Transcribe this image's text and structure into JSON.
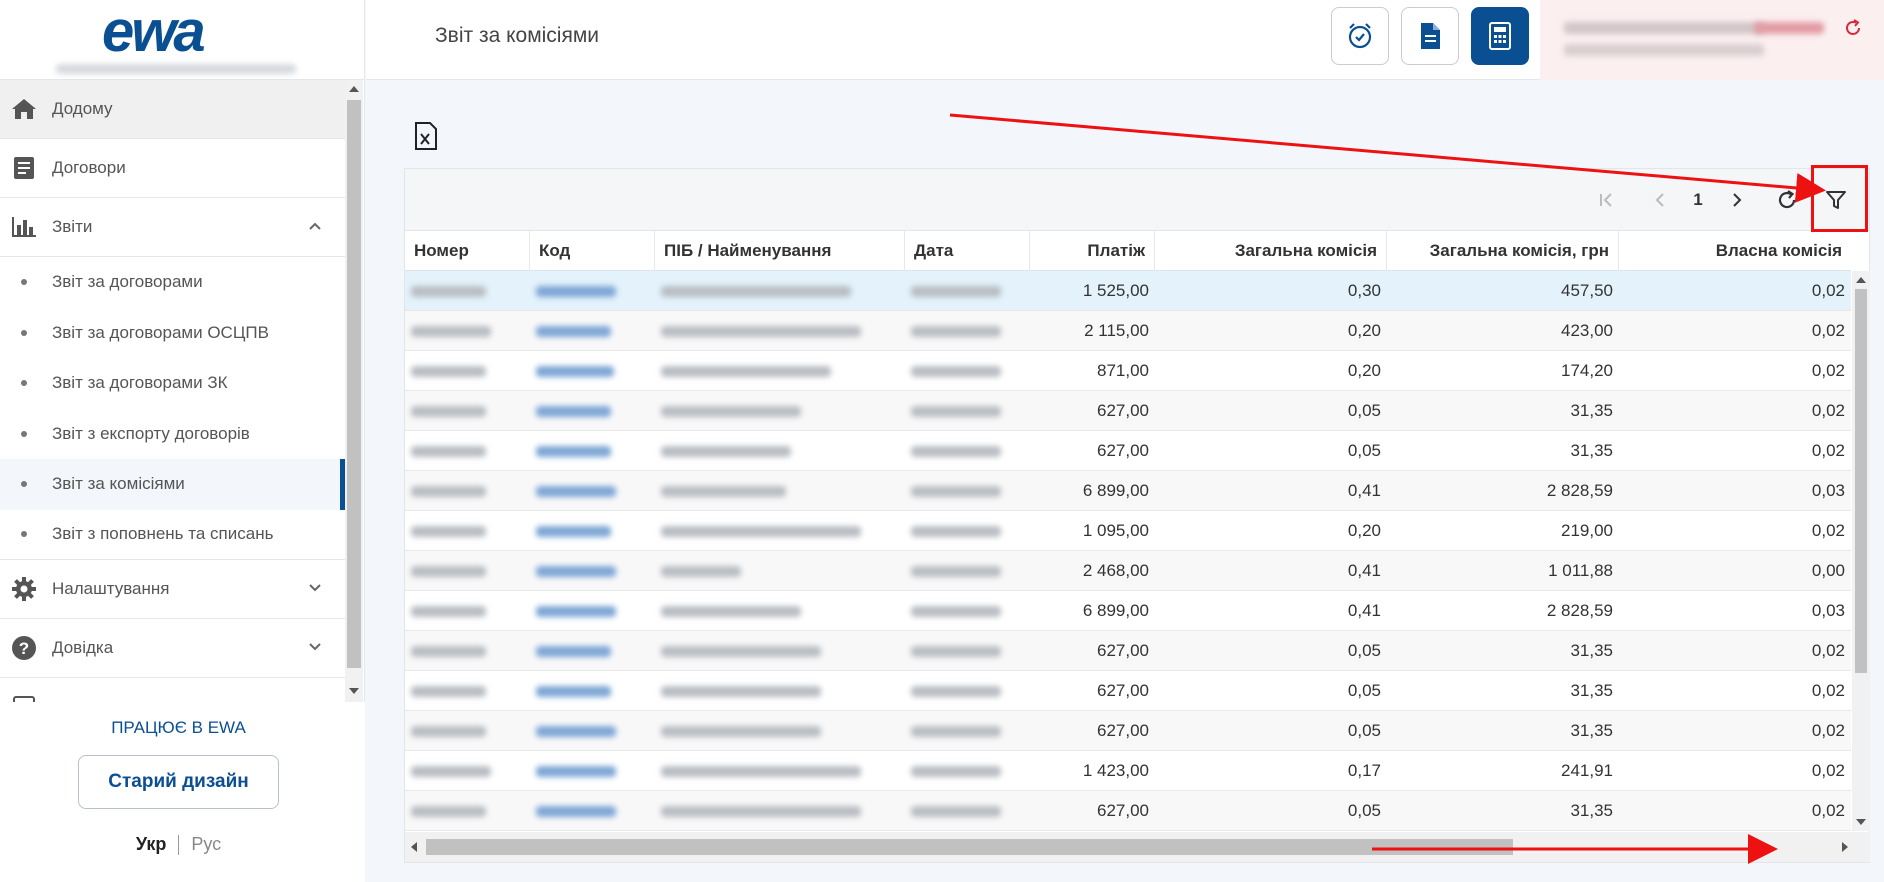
{
  "brand": {
    "logo_text": "ewa",
    "accent": "#0b4f93"
  },
  "sidebar": {
    "items": [
      {
        "label": "Додому",
        "icon": "home-icon"
      },
      {
        "label": "Договори",
        "icon": "document-list-icon"
      },
      {
        "label": "Звіти",
        "icon": "bar-chart-icon"
      },
      {
        "label": "Налаштування",
        "icon": "gear-icon"
      },
      {
        "label": "Довідка",
        "icon": "help-icon"
      }
    ],
    "reports_sub": [
      "Звіт за договорами",
      "Звіт за договорами ОСЦПВ",
      "Звіт за договорами ЗК",
      "Звіт з експорту договорів",
      "Звіт за комісіями",
      "Звіт з поповнень та списань"
    ],
    "footer": {
      "works_link": "ПРАЦЮЄ В EWA",
      "old_design_button": "Старий дизайн",
      "lang_ukr": "Укр",
      "lang_rus": "Рус"
    }
  },
  "header": {
    "title": "Звіт за комісіями",
    "buttons": [
      "alarm-clock-icon",
      "document-icon",
      "calculator-icon"
    ]
  },
  "grid": {
    "page": "1",
    "columns": [
      "Номер",
      "Код",
      "ПІБ / Найменування",
      "Дата",
      "Платіж",
      "Загальна комісія",
      "Загальна комісія, грн",
      "Власна комісія"
    ],
    "rows": [
      {
        "payment": "1 525,00",
        "commission": "0,30",
        "commission_uah": "457,50",
        "own": "0,02"
      },
      {
        "payment": "2 115,00",
        "commission": "0,20",
        "commission_uah": "423,00",
        "own": "0,02"
      },
      {
        "payment": "871,00",
        "commission": "0,20",
        "commission_uah": "174,20",
        "own": "0,02"
      },
      {
        "payment": "627,00",
        "commission": "0,05",
        "commission_uah": "31,35",
        "own": "0,02"
      },
      {
        "payment": "627,00",
        "commission": "0,05",
        "commission_uah": "31,35",
        "own": "0,02"
      },
      {
        "payment": "6 899,00",
        "commission": "0,41",
        "commission_uah": "2 828,59",
        "own": "0,03"
      },
      {
        "payment": "1 095,00",
        "commission": "0,20",
        "commission_uah": "219,00",
        "own": "0,02"
      },
      {
        "payment": "2 468,00",
        "commission": "0,41",
        "commission_uah": "1 011,88",
        "own": "0,00"
      },
      {
        "payment": "6 899,00",
        "commission": "0,41",
        "commission_uah": "2 828,59",
        "own": "0,03"
      },
      {
        "payment": "627,00",
        "commission": "0,05",
        "commission_uah": "31,35",
        "own": "0,02"
      },
      {
        "payment": "627,00",
        "commission": "0,05",
        "commission_uah": "31,35",
        "own": "0,02"
      },
      {
        "payment": "627,00",
        "commission": "0,05",
        "commission_uah": "31,35",
        "own": "0,02"
      },
      {
        "payment": "1 423,00",
        "commission": "0,17",
        "commission_uah": "241,91",
        "own": "0,02"
      },
      {
        "payment": "627,00",
        "commission": "0,05",
        "commission_uah": "31,35",
        "own": "0,02"
      }
    ]
  },
  "annotation_color": "#ee1111"
}
